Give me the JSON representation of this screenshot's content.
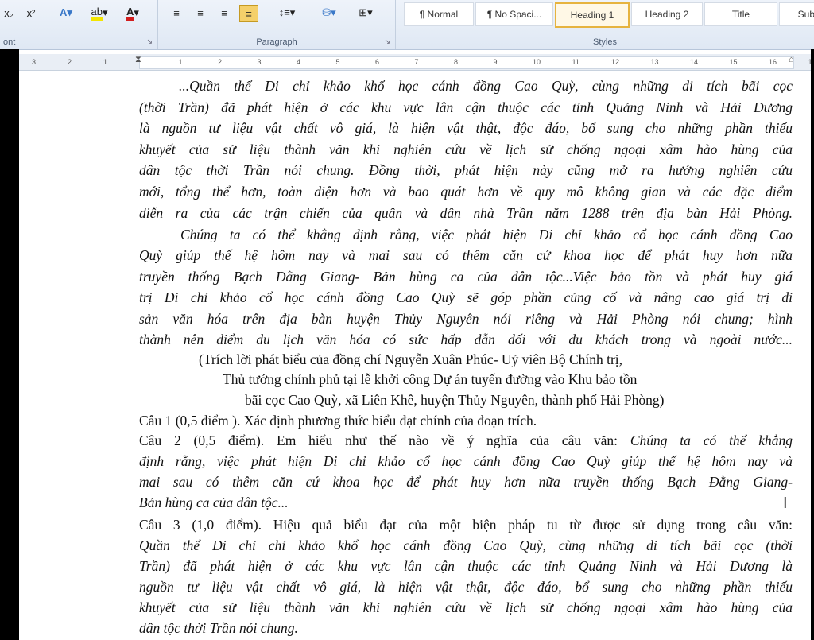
{
  "ribbon": {
    "font_group_label": "ont",
    "paragraph_label": "Paragraph",
    "styles_label": "Styles",
    "subscript": "x₂",
    "superscript": "x²",
    "styles": [
      "¶ Normal",
      "¶ No Spaci...",
      "Heading 1",
      "Heading 2",
      "Title",
      "Sub"
    ],
    "active_style": "Heading 1"
  },
  "ruler": [
    "3",
    "2",
    "1",
    "1",
    "2",
    "3",
    "4",
    "5",
    "6",
    "7",
    "8",
    "9",
    "10",
    "11",
    "12",
    "13",
    "14",
    "15",
    "16",
    "17"
  ],
  "doc": {
    "lines": [
      "...Quần thể Di chỉ khảo khổ học cánh đồng Cao Quỳ, cùng những di tích bãi cọc",
      "(thời Trần) đã phát hiện ở các khu vực lân cận thuộc các tỉnh Quảng Ninh và Hải Dương",
      "là nguồn tư liệu vật chất vô giá, là hiện vật thật, độc đáo, bổ sung cho những phần thiếu",
      "khuyết của sử liệu thành văn khi nghiên cứu về lịch sử chống ngoại xâm hào hùng của",
      "dân tộc thời Trần nói chung. Đồng thời, phát hiện này cũng mở ra hướng nghiên cứu",
      "mới, tổng thể hơn, toàn diện hơn và bao quát hơn về quy mô không gian và các đặc điểm",
      "diễn ra  của các trận chiến của quân và dân nhà Trần năm 1288 trên địa bàn Hải Phòng.",
      "Chúng ta có thể khẳng định rằng, việc phát hiện Di chỉ khảo cổ học cánh đồng Cao",
      "Quỳ giúp thế hệ hôm nay và mai sau có thêm căn cứ khoa học để phát huy hơn nữa",
      "truyền thống Bạch Đằng Giang- Bản hùng ca của dân tộc...Việc bảo tồn và phát huy giá",
      "trị Di chỉ khảo cổ học cánh đồng Cao Quỳ sẽ góp phần củng cố và nâng cao giá trị di",
      "sản văn hóa trên địa bàn huyện Thủy Nguyên nói riêng và Hải Phòng nói chung; hình",
      "thành nên điểm du lịch văn hóa có sức hấp dẫn đối với du khách trong và ngoài nước...",
      "(Trích lời phát biểu của đồng chí Nguyễn Xuân Phúc- Uỷ viên Bộ Chính trị,",
      "Thủ tướng chính phủ tại lễ khởi công Dự án tuyến đường vào Khu bảo tồn",
      "bãi cọc Cao Quỳ, xã Liên Khê, huyện Thủy Nguyên, thành phố Hải Phòng)",
      "Câu 1 (0,5 điểm ). Xác định phương thức biểu đạt chính của đoạn trích.",
      "Câu 2 (0,5 điểm). Em hiểu như thế nào về ý nghĩa của câu văn: ",
      "Chúng ta có thể khẳng",
      "định rằng, việc phát hiện Di chỉ khảo cổ học cánh đồng Cao Quỳ giúp thế hệ hôm nay và",
      "mai sau có thêm căn cứ khoa học để phát huy hơn nữa truyền thống Bạch Đằng Giang-",
      "Bản hùng ca của dân tộc...",
      "Câu 3 (1,0 điểm). Hiệu quả biểu đạt của một biện pháp tu từ được sử dụng trong câu văn:",
      "Quần thể Di chỉ chỉ khảo khổ học cánh đồng Cao Quỳ, cùng những di tích bãi cọc (thời",
      "Trần) đã phát hiện ở các khu vực lân cận thuộc các tỉnh Quảng Ninh và Hải Dương là",
      "nguồn tư liệu vật chất vô giá, là hiện vật thật, độc đáo, bổ sung cho những phần thiếu",
      "khuyết của sử liệu thành văn khi nghiên cứu về lịch sử chống ngoại xâm hào hùng của",
      "dân tộc thời Trần nói chung."
    ]
  }
}
